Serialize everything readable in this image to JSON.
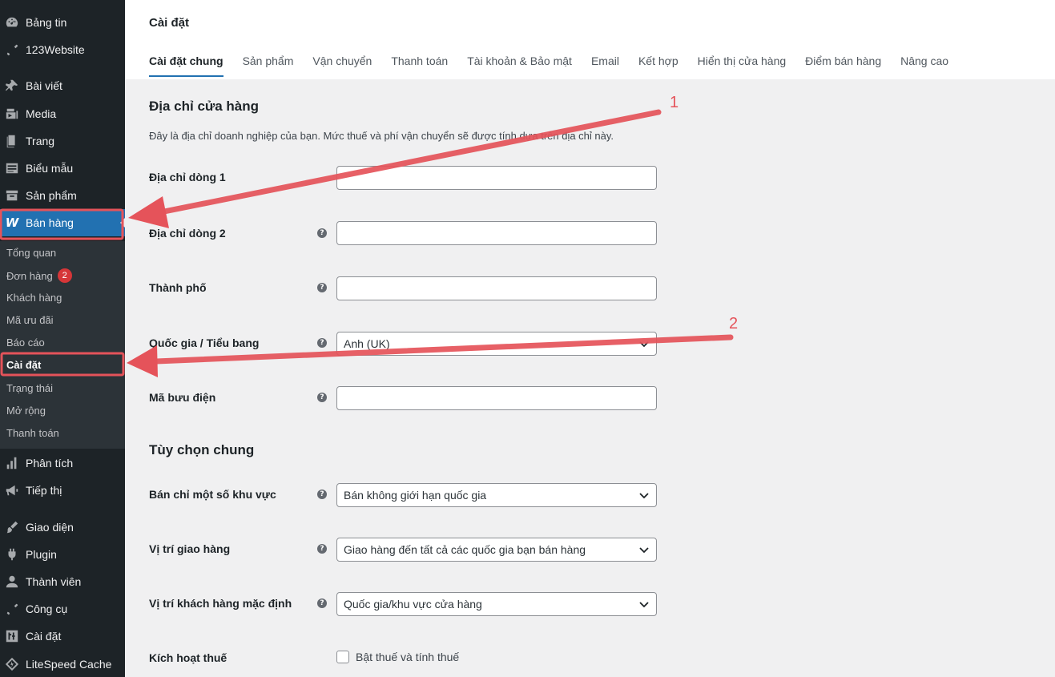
{
  "sidebar": {
    "top_items": [
      {
        "label": "Bảng tin",
        "icon": "dashboard-icon"
      },
      {
        "label": "123Website",
        "icon": "wrench-icon"
      },
      {
        "label": "Bài viết",
        "icon": "pin-icon"
      },
      {
        "label": "Media",
        "icon": "media-icon"
      },
      {
        "label": "Trang",
        "icon": "page-icon"
      },
      {
        "label": "Biểu mẫu",
        "icon": "form-icon"
      },
      {
        "label": "Sản phẩm",
        "icon": "archive-icon"
      }
    ],
    "active_item": {
      "label": "Bán hàng",
      "icon": "woocommerce-icon",
      "logo_text": "W"
    },
    "submenu": [
      {
        "label": "Tổng quan"
      },
      {
        "label": "Đơn hàng",
        "badge": "2"
      },
      {
        "label": "Khách hàng"
      },
      {
        "label": "Mã ưu đãi"
      },
      {
        "label": "Báo cáo"
      },
      {
        "label": "Cài đặt",
        "current": true
      },
      {
        "label": "Trạng thái"
      },
      {
        "label": "Mở rộng"
      },
      {
        "label": "Thanh toán"
      }
    ],
    "bottom_items": [
      {
        "label": "Phân tích",
        "icon": "chart-icon"
      },
      {
        "label": "Tiếp thị",
        "icon": "megaphone-icon"
      },
      {
        "label": "Giao diện",
        "icon": "brush-icon"
      },
      {
        "label": "Plugin",
        "icon": "plugin-icon"
      },
      {
        "label": "Thành viên",
        "icon": "user-icon"
      },
      {
        "label": "Công cụ",
        "icon": "tools-icon"
      },
      {
        "label": "Cài đặt",
        "icon": "settings-icon"
      },
      {
        "label": "LiteSpeed Cache",
        "icon": "litespeed-icon"
      }
    ]
  },
  "header": {
    "title": "Cài đặt",
    "tabs": [
      {
        "label": "Cài đặt chung",
        "active": true
      },
      {
        "label": "Sản phẩm"
      },
      {
        "label": "Vận chuyển"
      },
      {
        "label": "Thanh toán"
      },
      {
        "label": "Tài khoản & Bảo mật"
      },
      {
        "label": "Email"
      },
      {
        "label": "Kết hợp"
      },
      {
        "label": "Hiển thị cửa hàng"
      },
      {
        "label": "Điểm bán hàng"
      },
      {
        "label": "Nâng cao"
      }
    ]
  },
  "store_address": {
    "title": "Địa chỉ cửa hàng",
    "description": "Đây là địa chỉ doanh nghiệp của bạn. Mức thuế và phí vận chuyển sẽ được tính dựa trên địa chỉ này.",
    "fields": {
      "address1": {
        "label": "Địa chỉ dòng 1",
        "value": ""
      },
      "address2": {
        "label": "Địa chỉ dòng 2",
        "value": ""
      },
      "city": {
        "label": "Thành phố",
        "value": ""
      },
      "country": {
        "label": "Quốc gia / Tiểu bang",
        "value": "Anh (UK)"
      },
      "postcode": {
        "label": "Mã bưu điện",
        "value": ""
      }
    }
  },
  "general_options": {
    "title": "Tùy chọn chung",
    "fields": {
      "selling_location": {
        "label": "Bán chỉ một số khu vực",
        "value": "Bán không giới hạn quốc gia"
      },
      "shipping_location": {
        "label": "Vị trí giao hàng",
        "value": "Giao hàng đến tất cả các quốc gia bạn bán hàng"
      },
      "default_customer_location": {
        "label": "Vị trí khách hàng mặc định",
        "value": "Quốc gia/khu vực cửa hàng"
      },
      "enable_taxes": {
        "label": "Kích hoạt thuế",
        "checkbox_label": "Bật thuế và tính thuế",
        "checked": false
      }
    }
  },
  "help_glyph": "?",
  "annotations": {
    "label_1": "1",
    "label_2": "2",
    "color": "#e5535a"
  }
}
